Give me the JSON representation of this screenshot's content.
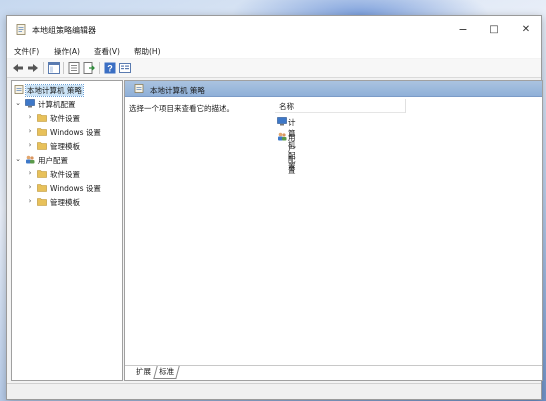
{
  "window": {
    "title": "本地组策略编辑器",
    "minimize": "−",
    "maximize": "□",
    "close": "✕"
  },
  "menu": [
    "文件(F)",
    "操作(A)",
    "查看(V)",
    "帮助(H)"
  ],
  "toolbar": {
    "icons": [
      "back-icon",
      "forward-icon",
      "show-tree-icon",
      "properties-icon",
      "export-icon",
      "help-icon",
      "view-icon"
    ]
  },
  "tree": {
    "root": "本地计算机 策略",
    "nodes": [
      {
        "label": "计算机配置",
        "children": [
          "软件设置",
          "Windows 设置",
          "管理模板"
        ]
      },
      {
        "label": "用户配置",
        "children": [
          "软件设置",
          "Windows 设置",
          "管理模板"
        ]
      }
    ]
  },
  "content": {
    "header": "本地计算机 策略",
    "description": "选择一个项目来查看它的描述。",
    "column_name": "名称",
    "items": [
      "计算机配置",
      "用户配置"
    ]
  },
  "tabs": {
    "extended": "扩展",
    "standard": "标准"
  },
  "colors": {
    "header_bg": "#9ab8dc",
    "selection": "#cce4f7",
    "folder": "#e8c15a"
  }
}
